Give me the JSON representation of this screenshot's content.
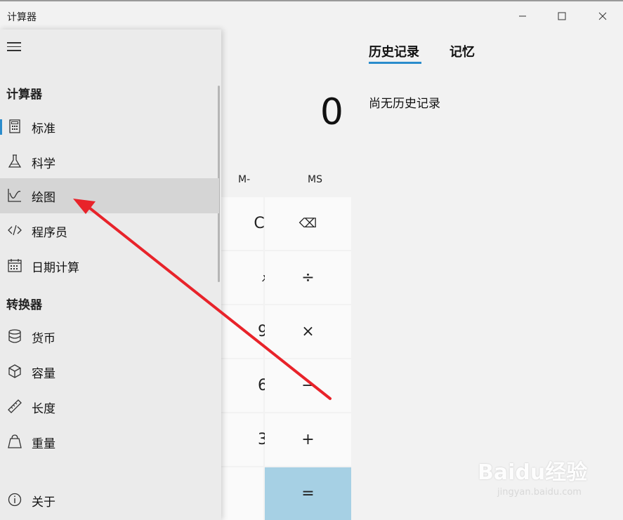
{
  "window": {
    "title": "计算器",
    "minimize": "–",
    "maximize": "☐",
    "close": "✕"
  },
  "display": {
    "value": "0"
  },
  "memory_row": {
    "m_minus": "M-",
    "ms": "MS"
  },
  "keys": {
    "backspace": "⌫",
    "divide": "÷",
    "multiply": "×",
    "minus": "−",
    "plus": "+",
    "equals": "=",
    "partial_c": "C",
    "partial_sqrt": "x",
    "partial_9": "9",
    "partial_6": "6",
    "partial_3": "3"
  },
  "history_panel": {
    "tabs": [
      "历史记录",
      "记忆"
    ],
    "active_tab": "历史记录",
    "empty_message": "尚无历史记录"
  },
  "nav": {
    "sections": [
      {
        "header": "计算器",
        "items": [
          {
            "label": "标准",
            "icon": "calculator-icon"
          },
          {
            "label": "科学",
            "icon": "flask-icon"
          },
          {
            "label": "绘图",
            "icon": "graph-icon"
          },
          {
            "label": "程序员",
            "icon": "code-icon"
          },
          {
            "label": "日期计算",
            "icon": "calendar-icon"
          }
        ]
      },
      {
        "header": "转换器",
        "items": [
          {
            "label": "货币",
            "icon": "coins-icon"
          },
          {
            "label": "容量",
            "icon": "cube-icon"
          },
          {
            "label": "长度",
            "icon": "ruler-icon"
          },
          {
            "label": "重量",
            "icon": "weight-icon"
          }
        ]
      }
    ],
    "active_item": "标准",
    "hovered_item": "绘图",
    "footer": {
      "label": "关于",
      "icon": "info-icon"
    }
  },
  "annotation": {
    "color": "#e8232a"
  },
  "watermark": {
    "text": "Baidu经验",
    "sub": "jingyan.baidu.com"
  },
  "colors": {
    "accent": "#2b8ccc",
    "equals_key": "#a6d0e4"
  }
}
